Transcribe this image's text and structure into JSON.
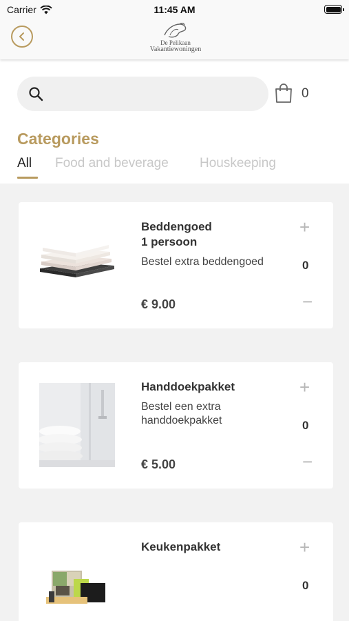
{
  "status_bar": {
    "carrier": "Carrier",
    "time": "11:45 AM"
  },
  "nav": {
    "logo_line1": "De Pelikaan",
    "logo_line2": "Vakantiewoningen",
    "accent_color": "#b89a5e"
  },
  "search": {
    "placeholder": ""
  },
  "cart": {
    "count": "0"
  },
  "categories": {
    "title": "Categories",
    "tabs": [
      {
        "label": "All",
        "active": true
      },
      {
        "label": "Food and beverage",
        "active": false
      },
      {
        "label": "Houskeeping",
        "active": false
      }
    ]
  },
  "products": [
    {
      "title_line1": "Beddengoed",
      "title_line2": "1 persoon",
      "desc_line1": "Bestel extra beddengoed",
      "desc_line2": "",
      "price": "€ 9.00",
      "quantity": "0",
      "image": "folded-bed-linen"
    },
    {
      "title_line1": "Handdoekpakket",
      "title_line2": "",
      "desc_line1": "Bestel een extra",
      "desc_line2": "handdoekpakket",
      "price": "€ 5.00",
      "quantity": "0",
      "image": "towels-bathroom"
    },
    {
      "title_line1": "Keukenpakket",
      "title_line2": "",
      "desc_line1": "",
      "desc_line2": "",
      "price": "",
      "quantity": "0",
      "image": "kitchen-package"
    }
  ],
  "buttons": {
    "plus": "+",
    "minus": "−"
  }
}
